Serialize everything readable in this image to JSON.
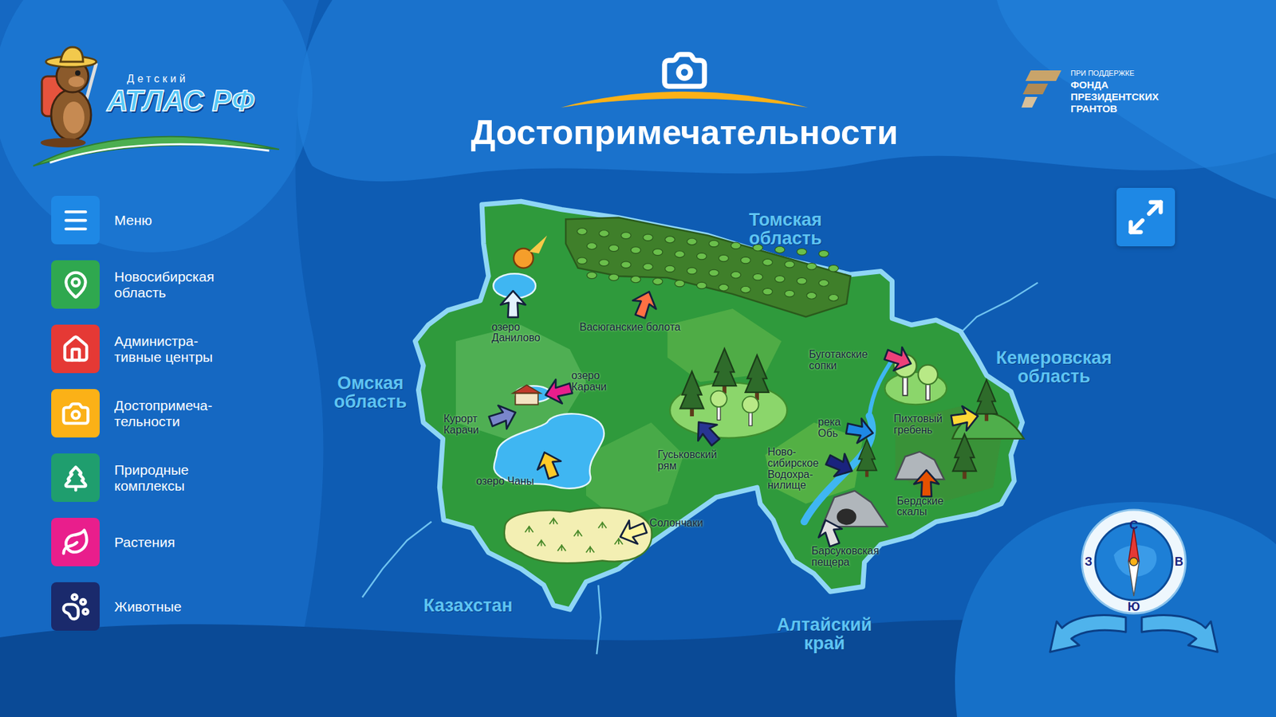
{
  "logo": {
    "small": "Детский",
    "big": "АТЛАС РФ"
  },
  "sponsor": {
    "lines": [
      "ПРИ ПОДДЕРЖКЕ",
      "ФОНДА",
      "ПРЕЗИДЕНТСКИХ",
      "ГРАНТОВ"
    ]
  },
  "title": "Достопримечательности",
  "menu": [
    {
      "lines": [
        "Меню"
      ],
      "color": "#1e88e5"
    },
    {
      "lines": [
        "Новосибирская",
        "область"
      ],
      "color": "#2fa84f"
    },
    {
      "lines": [
        "Администра-",
        "тивные центры"
      ],
      "color": "#e53935"
    },
    {
      "lines": [
        "Достопримеча-",
        "тельности"
      ],
      "color": "#fbb117"
    },
    {
      "lines": [
        "Природные",
        "комплексы"
      ],
      "color": "#1f9e6e"
    },
    {
      "lines": [
        "Растения"
      ],
      "color": "#e91e8c"
    },
    {
      "lines": [
        "Животные"
      ],
      "color": "#1a2a6c"
    }
  ],
  "neighbors": [
    {
      "lines": [
        "Томская",
        "область"
      ]
    },
    {
      "lines": [
        "Омская",
        "область"
      ]
    },
    {
      "lines": [
        "Кемеровская",
        "область"
      ]
    },
    {
      "lines": [
        "Казахстан"
      ]
    },
    {
      "lines": [
        "Алтайский",
        "край"
      ]
    }
  ],
  "attractions": [
    {
      "lines": [
        "озеро",
        "Данилово"
      ],
      "color": "#e3f2fd"
    },
    {
      "lines": [
        "Васюганские болота"
      ],
      "color": "#ff7043"
    },
    {
      "lines": [
        "озеро",
        "Карачи"
      ],
      "color": "#e91e8c"
    },
    {
      "lines": [
        "Курорт",
        "Карачи"
      ],
      "color": "#7986cb"
    },
    {
      "lines": [
        "озеро Чаны"
      ],
      "color": "#ffca28"
    },
    {
      "lines": [
        "Солончаки"
      ],
      "color": "#fff59d"
    },
    {
      "lines": [
        "Гуськовский",
        "рям"
      ],
      "color": "#283593"
    },
    {
      "lines": [
        "Буготакские",
        "сопки"
      ],
      "color": "#ec407a"
    },
    {
      "lines": [
        "река",
        "Обь"
      ],
      "color": "#1e88e5"
    },
    {
      "lines": [
        "Ново-",
        "сибирское",
        "Водохра-",
        "нилище"
      ],
      "color": "#1a237e"
    },
    {
      "lines": [
        "Пихтовый",
        "гребень"
      ],
      "color": "#fdd835"
    },
    {
      "lines": [
        "Бердские",
        "скалы"
      ],
      "color": "#e65100"
    },
    {
      "lines": [
        "Барсуковская",
        "пещера"
      ],
      "color": "#e0e0e0"
    }
  ],
  "compass": {
    "north": "С",
    "east": "В",
    "south": "Ю",
    "west": "З"
  }
}
